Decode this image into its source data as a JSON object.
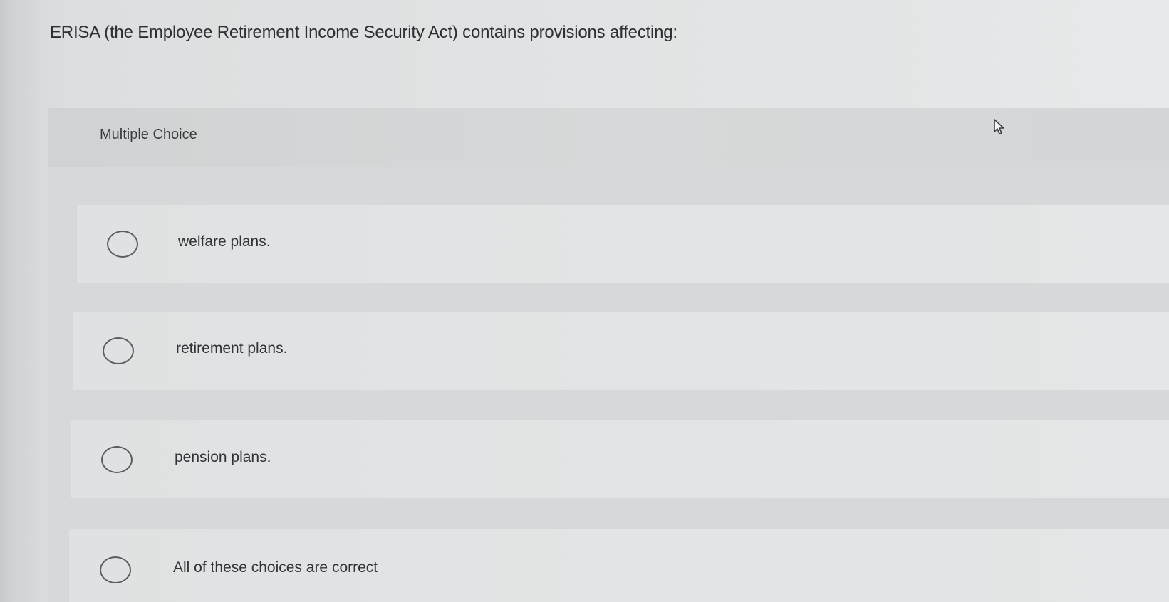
{
  "question": {
    "text": "ERISA (the Employee Retirement Income Security Act) contains provisions affecting:"
  },
  "question_type": "Multiple Choice",
  "options": [
    {
      "label": "welfare plans."
    },
    {
      "label": "retirement plans."
    },
    {
      "label": "pension plans."
    },
    {
      "label": "All of these choices are correct"
    }
  ],
  "icons": {
    "radio": "radio-unselected-icon",
    "cursor": "mouse-pointer-icon"
  }
}
